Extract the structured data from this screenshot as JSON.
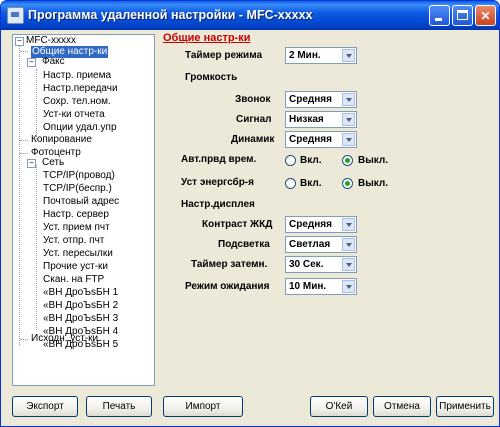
{
  "window": {
    "title": "Программа удаленной настройки - MFC-xxxxx"
  },
  "tree": {
    "root": "MFC-xxxxx",
    "items": [
      "Общие настр-ки",
      "Факс",
      "Настр. приема",
      "Настр.передачи",
      "Сохр. тел.ном.",
      "Уст-ки отчета",
      "Опции удал.упр",
      "Копирование",
      "Фотоцентр",
      "Сеть",
      "TCP/IP(провод)",
      "TCP/IP(беспр.)",
      "Почтовый адрес",
      "Настр. сервер",
      "Уст. прием пчт",
      "Уст. отпр. пчт",
      "Уст. пересылки",
      "Прочие уст-ки",
      "Скан. на FTP",
      "«ВН ДроЪsБН 1",
      "«ВН ДроЪsБН 2",
      "«ВН ДроЪsБН 3",
      "«ВН ДроЪsБН 4",
      "«ВН ДроЪsБН 5",
      "Исходн. уст-ки"
    ]
  },
  "panel": {
    "title": "Общие настр-ки",
    "mode_timer_label": "Таймер режима",
    "mode_timer_value": "2 Мин.",
    "volume_label": "Громкость",
    "ring_label": "Звонок",
    "ring_value": "Средняя",
    "beeper_label": "Сигнал",
    "beeper_value": "Низкая",
    "speaker_label": "Динамик",
    "speaker_value": "Средняя",
    "auto_dst_label": "Авт.првд врем.",
    "auto_dst_on": "Вкл.",
    "auto_dst_off": "Выкл.",
    "eco_label": "Уст энергсбр-я",
    "eco_on": "Вкл.",
    "eco_off": "Выкл.",
    "display_label": "Настр.дисплея",
    "contrast_label": "Контраст ЖКД",
    "contrast_value": "Средняя",
    "backlight_label": "Подсветка",
    "backlight_value": "Светлая",
    "dim_timer_label": "Таймер затемн.",
    "dim_timer_value": "30 Сек.",
    "sleep_label": "Режим ожидания",
    "sleep_value": "10 Мин."
  },
  "buttons": {
    "export": "Экспорт",
    "print": "Печать",
    "import": "Импорт",
    "ok": "О'Кей",
    "cancel": "Отмена",
    "apply": "Применить"
  }
}
